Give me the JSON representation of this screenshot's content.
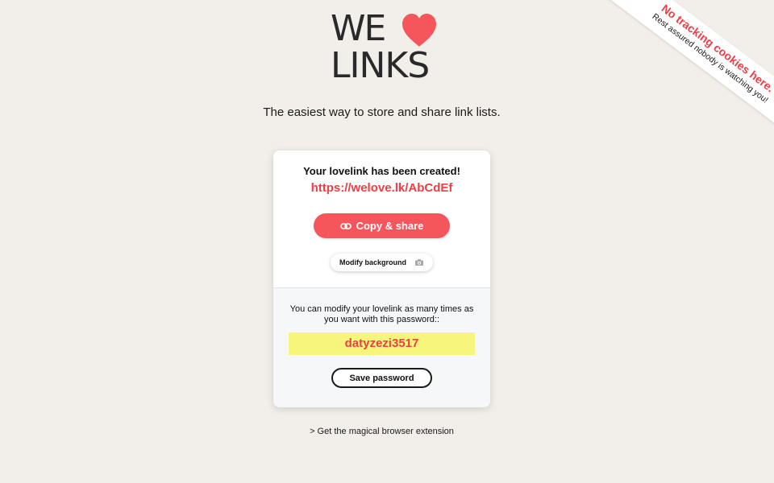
{
  "logo": {
    "line1": "WE",
    "heart_icon": "heart-icon",
    "line2": "LINKS",
    "heart_color": "#f5565c"
  },
  "tagline": "The easiest way to store and share link lists.",
  "ribbon": {
    "headline": "No tracking cookies here.",
    "subline": "Rest assured nobody is watching you!"
  },
  "card": {
    "title": "Your lovelink has been created!",
    "link": "https://welove.lk/AbCdEf",
    "copy_button": {
      "icon": "link-icon",
      "label": "Copy & share"
    },
    "background_button": {
      "label": "Modify background",
      "icon": "camera-icon"
    },
    "modify_text": "You can modify your lovelink as many times as you want with this password::",
    "password": "datyzezi3517",
    "save_button": "Save password"
  },
  "extension_link": "> Get the magical browser extension",
  "colors": {
    "accent": "#ee3e45",
    "button": "#f5565c",
    "highlight": "#f8f57c",
    "background": "#f2efea"
  }
}
